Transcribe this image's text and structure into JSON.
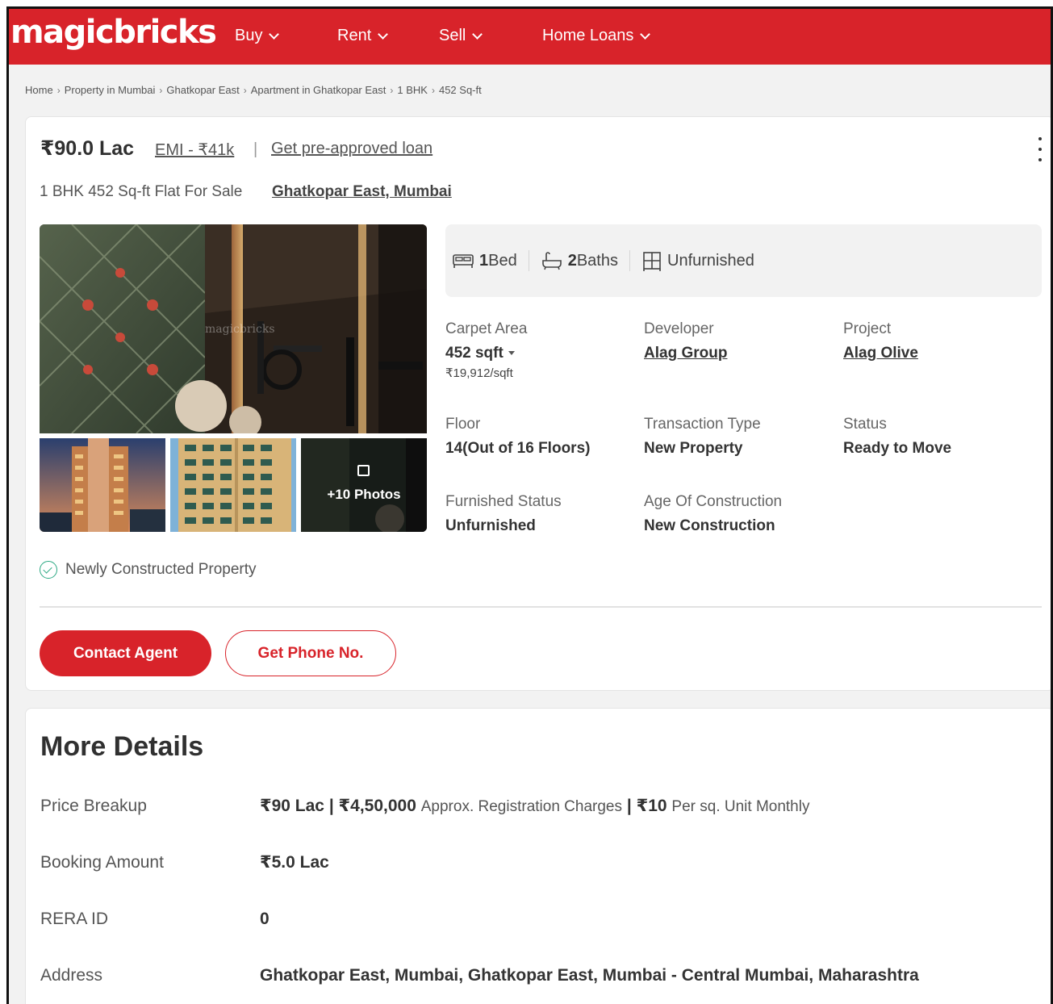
{
  "header": {
    "logo": "magicbricks",
    "nav": [
      {
        "label": "Buy"
      },
      {
        "label": "Rent"
      },
      {
        "label": "Sell"
      },
      {
        "label": "Home Loans"
      }
    ]
  },
  "breadcrumb": [
    "Home",
    "Property in Mumbai",
    "Ghatkopar East",
    "Apartment in Ghatkopar East",
    "1 BHK",
    "452 Sq-ft"
  ],
  "listing": {
    "price": "₹90.0 Lac",
    "emi": "EMI - ₹41k",
    "separator": "|",
    "loan_link": "Get pre-approved loan",
    "subtitle": "1 BHK 452 Sq-ft Flat For Sale",
    "location": "Ghatkopar East, Mumbai",
    "photos_more": "+10 Photos",
    "amenities": [
      {
        "icon": "bed-icon",
        "value": "1",
        "label": "Bed"
      },
      {
        "icon": "bath-icon",
        "value": "2",
        "label": "Baths"
      },
      {
        "icon": "furniture-icon",
        "value": "",
        "label": "Unfurnished"
      }
    ],
    "details": {
      "carpet_area": {
        "label": "Carpet Area",
        "value": "452 sqft",
        "sub": "₹19,912/sqft"
      },
      "developer": {
        "label": "Developer",
        "value": "Alag Group"
      },
      "project": {
        "label": "Project",
        "value": "Alag Olive"
      },
      "floor": {
        "label": "Floor",
        "value": "14(Out of 16 Floors)"
      },
      "transaction": {
        "label": "Transaction Type",
        "value": "New Property"
      },
      "status": {
        "label": "Status",
        "value": "Ready to Move"
      },
      "furnished": {
        "label": "Furnished Status",
        "value": "Unfurnished"
      },
      "age": {
        "label": "Age Of Construction",
        "value": "New Construction"
      }
    },
    "badge": "Newly Constructed Property",
    "contact_button": "Contact Agent",
    "phone_button": "Get Phone No."
  },
  "more_details": {
    "title": "More Details",
    "price_breakup": {
      "label": "Price Breakup",
      "price": "₹90 Lac | ₹4,50,000",
      "reg": "Approx. Registration Charges",
      "pipe": "|",
      "maint": "₹10",
      "unit": "Per sq. Unit Monthly"
    },
    "booking": {
      "label": "Booking Amount",
      "value": "₹5.0 Lac"
    },
    "rera": {
      "label": "RERA ID",
      "value": "0"
    },
    "address": {
      "label": "Address",
      "value": "Ghatkopar East, Mumbai, Ghatkopar East, Mumbai - Central Mumbai, Maharashtra"
    }
  },
  "colors": {
    "brand": "#d8232a",
    "text": "#303030",
    "badge": "#2aa882"
  }
}
